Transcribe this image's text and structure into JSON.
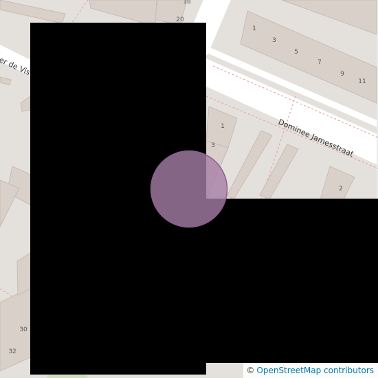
{
  "streets": [
    {
      "name": "Dominee Jamesstraat"
    },
    {
      "name": "ter de Vis"
    }
  ],
  "house_numbers": [
    "1",
    "3",
    "5",
    "7",
    "9",
    "11",
    "1",
    "3",
    "2",
    "20",
    "18",
    "30",
    "32"
  ],
  "marker": {
    "fill": "#a67ea6",
    "stroke": "#8a5f8a"
  },
  "attribution": {
    "symbol": "©",
    "link_text": "OpenStreetMap contributors"
  },
  "colors": {
    "background": "#f2efe9",
    "building": "#d9d0c9",
    "road": "#ffffff",
    "mask": "#000000",
    "property_line": "#e8a6a6"
  }
}
